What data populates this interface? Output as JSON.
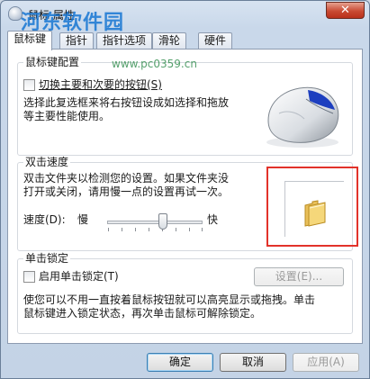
{
  "window": {
    "title": "鼠标 属性",
    "close_glyph": "✕",
    "watermark_title": "河东软件园",
    "watermark_url": "www.pc0359.cn"
  },
  "tabs": [
    {
      "label": "鼠标键",
      "active": true
    },
    {
      "label": "指针",
      "active": false
    },
    {
      "label": "指针选项",
      "active": false
    },
    {
      "label": "滑轮",
      "active": false
    },
    {
      "label": "硬件",
      "active": false
    }
  ],
  "button_config": {
    "legend": "鼠标键配置",
    "switch_label": "切换主要和次要的按钮(S)",
    "switch_checked": false,
    "description_line1": "选择此复选框来将右按钮设成如选择和拖放",
    "description_line2": "等主要性能使用。"
  },
  "double_click": {
    "legend": "双击速度",
    "description_line1": "双击文件夹以检测您的设置。如果文件夹没",
    "description_line2": "打开或关闭，请用慢一点的设置再试一次。",
    "speed_label": "速度(D):",
    "slow_label": "慢",
    "fast_label": "快",
    "speed_value_fraction": 0.55
  },
  "click_lock": {
    "legend": "单击锁定",
    "enable_label": "启用单击锁定(T)",
    "enable_checked": false,
    "settings_button": "设置(E)...",
    "description_line1": "使您可以不用一直按着鼠标按钮就可以高亮显示或拖拽。单击",
    "description_line2": "鼠标键进入锁定状态，再次单击鼠标可解除锁定。"
  },
  "footer": {
    "ok": "确定",
    "cancel": "取消",
    "apply": "应用(A)"
  }
}
